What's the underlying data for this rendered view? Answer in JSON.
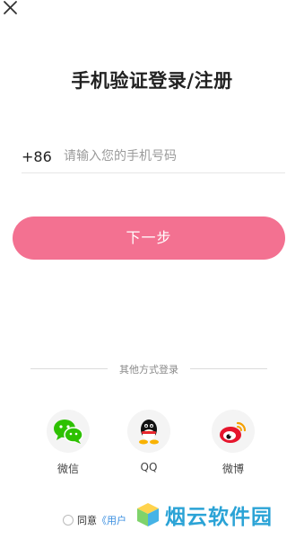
{
  "header": {
    "close_icon": "close-icon",
    "title": "手机验证登录/注册"
  },
  "phone": {
    "country_code": "+86",
    "placeholder": "请输入您的手机号码",
    "value": ""
  },
  "actions": {
    "next_label": "下一步"
  },
  "other_login": {
    "divider_text": "其他方式登录",
    "options": [
      {
        "label": "微信",
        "icon": "wechat-icon",
        "color": "#2dc100"
      },
      {
        "label": "QQ",
        "icon": "qq-icon",
        "color": "#111111"
      },
      {
        "label": "微博",
        "icon": "weibo-icon",
        "color": "#e6162d"
      }
    ]
  },
  "agreement": {
    "prefix": "同意",
    "link_text": "《用户"
  },
  "watermark": {
    "text": "烟云软件园",
    "icon": "cube-logo-icon"
  },
  "colors": {
    "primary": "#f37191",
    "title": "#222222",
    "placeholder": "#9b9b9b",
    "link": "#3b8fe0",
    "watermark": "#2ba3d6"
  }
}
